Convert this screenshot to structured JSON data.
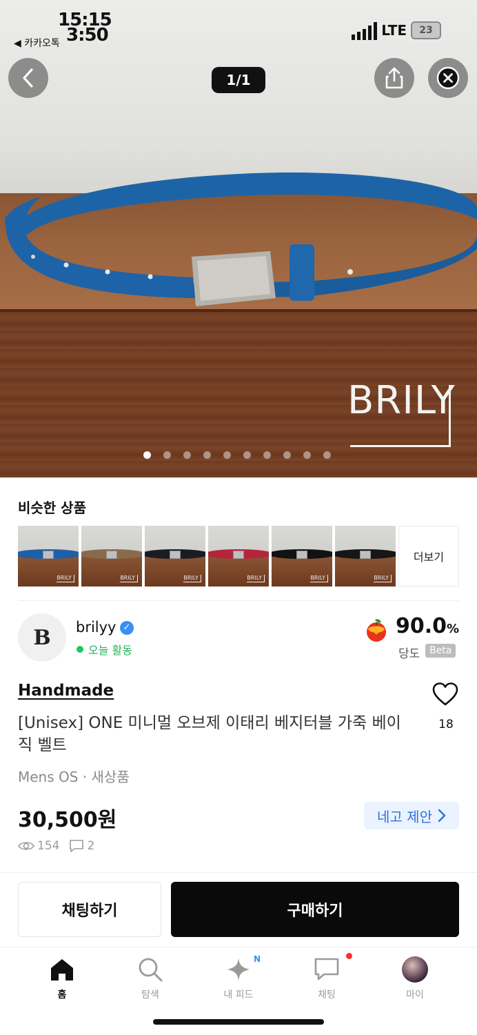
{
  "status_bar": {
    "time_primary": "15:15",
    "time_overlay": "3:50",
    "back_app_label": "◀ 카카오톡",
    "network": "LTE",
    "battery": "23"
  },
  "hero": {
    "pager": "1/1",
    "watermark": "BRILY",
    "dots_total": 10,
    "dots_active_index": 0
  },
  "similar": {
    "title": "비슷한 상품",
    "more_label": "더보기",
    "items": [
      {
        "belt_color": "#1f5fa8",
        "brand": "BRILY"
      },
      {
        "belt_color": "#8a6a4d",
        "brand": "BRILY"
      },
      {
        "belt_color": "#1b1b22",
        "brand": "BRILY"
      },
      {
        "belt_color": "#b3263a",
        "brand": "BRILY"
      },
      {
        "belt_color": "#121212",
        "brand": "BRILY"
      },
      {
        "belt_color": "#161616",
        "brand": "BRILY"
      }
    ]
  },
  "seller": {
    "avatar_letter": "B",
    "name": "brilyy",
    "activity": "오늘 활동",
    "score": "90.0",
    "score_unit": "%",
    "score_label": "당도",
    "score_badge": "Beta"
  },
  "product": {
    "brand": "Handmade",
    "title": "[Unisex] ONE 미니멀 오브제 이태리 베지터블 가죽 베이직 벨트",
    "likes": "18",
    "meta": "Mens OS · 새상품",
    "price": "30,500원",
    "offer_label": "네고 제안",
    "views": "154",
    "comments": "2"
  },
  "actions": {
    "chat_label": "채팅하기",
    "buy_label": "구매하기"
  },
  "tabbar": {
    "tabs": [
      {
        "label": "홈",
        "icon": "home-icon"
      },
      {
        "label": "탐색",
        "icon": "search-icon"
      },
      {
        "label": "내 피드",
        "icon": "sparkle-icon",
        "badge": "N"
      },
      {
        "label": "채팅",
        "icon": "chat-icon"
      },
      {
        "label": "마이",
        "icon": "profile-avatar"
      }
    ]
  },
  "colors": {
    "active_green": "#22b35e",
    "offer_blue": "#2f6fd6",
    "verified_blue": "#3a8ef6",
    "notification_red": "#ff2d2d"
  }
}
